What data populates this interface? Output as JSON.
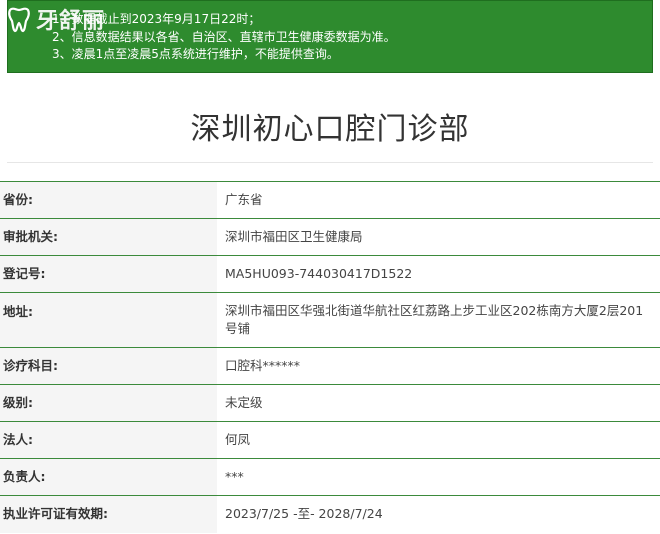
{
  "notice": {
    "lines": [
      "1、数据截止到2023年9月17日22时；",
      "2、信息数据结果以各省、自治区、直辖市卫生健康委数据为准。",
      "3、凌晨1点至凌晨5点系统进行维护，不能提供查询。"
    ]
  },
  "logo": {
    "text": "牙舒丽",
    "icon": "tooth-icon"
  },
  "page": {
    "title": "深圳初心口腔门诊部"
  },
  "info": {
    "province": {
      "label": "省份:",
      "value": "广东省"
    },
    "authority": {
      "label": "审批机关:",
      "value": "深圳市福田区卫生健康局"
    },
    "reg_no": {
      "label": "登记号:",
      "value": "MA5HU093-744030417D1522"
    },
    "address": {
      "label": "地址:",
      "value": "深圳市福田区华强北街道华航社区红荔路上步工业区202栋南方大厦2层201号铺"
    },
    "dept": {
      "label": "诊疗科目:",
      "value": "口腔科******"
    },
    "level": {
      "label": "级别:",
      "value": "未定级"
    },
    "legal": {
      "label": "法人:",
      "value": "何凤"
    },
    "principal": {
      "label": "负责人:",
      "value": "***"
    },
    "validity": {
      "label": "执业许可证有效期:",
      "value": "2023/7/25 -至- 2028/7/24"
    }
  },
  "colors": {
    "notice_bg": "#2e8b2e",
    "row_border": "#3b8a3b"
  }
}
